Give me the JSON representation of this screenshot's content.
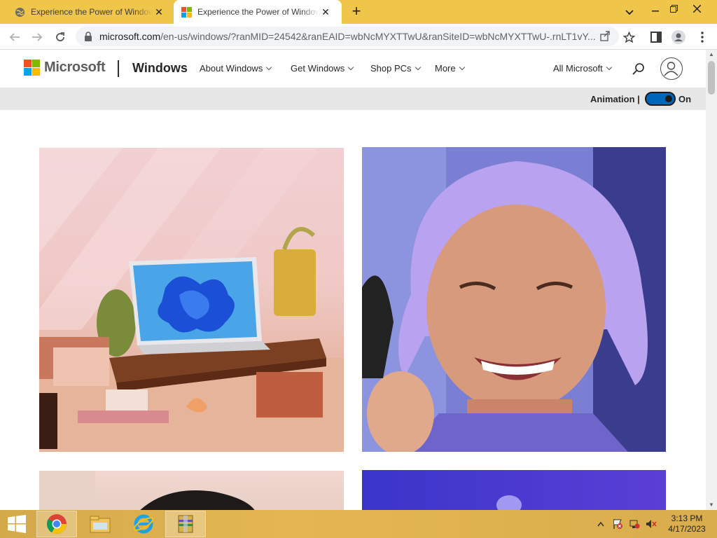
{
  "browser": {
    "tabs": [
      {
        "title": "Experience the Power of Windows",
        "active": false,
        "favicon": "globe-icon"
      },
      {
        "title": "Experience the Power of Windows",
        "active": true,
        "favicon": "windows-icon"
      }
    ],
    "new_tab_label": "+",
    "url_host": "microsoft.com",
    "url_path": "/en-us/windows/?ranMID=24542&ranEAID=wbNcMYXTTwU&ranSiteID=wbNcMYXTTwU-.rnLT1vY...",
    "colors": {
      "frame": "#f0c64a",
      "active_tab": "#ffffff"
    }
  },
  "site": {
    "brand": "Microsoft",
    "product": "Windows",
    "nav": [
      {
        "label": "About Windows"
      },
      {
        "label": "Get Windows"
      },
      {
        "label": "Shop PCs"
      },
      {
        "label": "More"
      }
    ],
    "all_microsoft": "All Microsoft",
    "animation_label": "Animation |",
    "animation_state": "On",
    "logo_colors": [
      "#f25022",
      "#7fba00",
      "#00a4ef",
      "#ffb900"
    ],
    "accent": "#0067b8"
  },
  "tiles": [
    {
      "subject": "laptop with Windows 11 bloom wallpaper on wooden desk"
    },
    {
      "subject": "smiling person with lavender hair"
    },
    {
      "subject": "person partially visible"
    },
    {
      "subject": "purple gradient"
    }
  ],
  "taskbar": {
    "apps": [
      "chrome-icon",
      "file-explorer-icon",
      "internet-explorer-icon",
      "archive-icon"
    ],
    "time": "3:13 PM",
    "date": "4/17/2023"
  }
}
